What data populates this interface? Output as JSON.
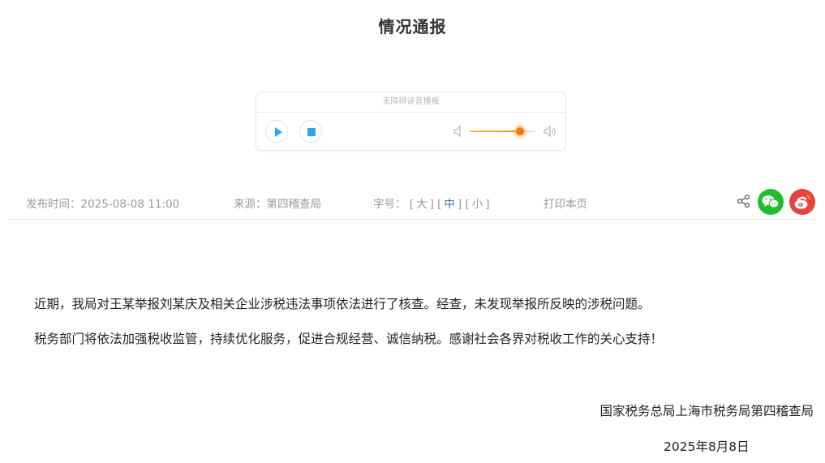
{
  "page": {
    "title": "情况通报"
  },
  "player": {
    "header_label": "无障碍读音播报",
    "volume_level": 0.78,
    "accent_color": "#2fa4e7",
    "volume_color": "#f07a10"
  },
  "meta": {
    "publish_label": "发布时间：",
    "publish_time": "2025-08-08 11:00",
    "source_label": "来源：",
    "source": "第四稽查局",
    "fontsize_label": "字号：",
    "fontsize_large": "大",
    "fontsize_medium": "中",
    "fontsize_small": "小",
    "print_label": "打印本页",
    "share_icons": [
      "share-icon",
      "wechat-icon",
      "weibo-icon"
    ],
    "wechat_color": "#1fbd2f",
    "weibo_color": "#e64242"
  },
  "content": {
    "paragraphs": [
      "近期，我局对王某举报刘某庆及相关企业涉税违法事项依法进行了核查。经查，未发现举报所反映的涉税问题。",
      "税务部门将依法加强税收监管，持续优化服务，促进合规经营、诚信纳税。感谢社会各界对税收工作的关心支持！"
    ],
    "signature_org": "国家税务总局上海市税务局第四稽查局",
    "signature_date": "2025年8月8日"
  }
}
